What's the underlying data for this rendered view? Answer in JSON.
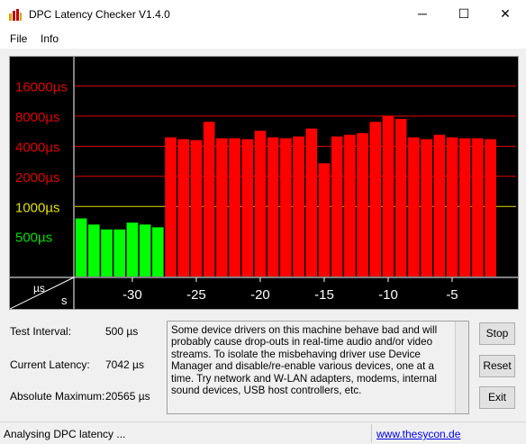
{
  "window": {
    "title": "DPC Latency Checker V1.4.0",
    "minimize_glyph": "─",
    "maximize_glyph": "☐",
    "close_glyph": "✕"
  },
  "menu": {
    "items": [
      "File",
      "Info"
    ]
  },
  "chart_data": {
    "type": "bar",
    "xlabel": "s",
    "ylabel": "µs",
    "scale": "log",
    "y_ticks": [
      {
        "label": "16000µs",
        "value": 16000,
        "color": "#e00000"
      },
      {
        "label": "8000µs",
        "value": 8000,
        "color": "#e00000"
      },
      {
        "label": "4000µs",
        "value": 4000,
        "color": "#e00000"
      },
      {
        "label": "2000µs",
        "value": 2000,
        "color": "#e00000"
      },
      {
        "label": "1000µs",
        "value": 1000,
        "color": "#e0e000"
      },
      {
        "label": "500µs",
        "value": 500,
        "color": "#00e000"
      }
    ],
    "x_ticks": [
      "-30",
      "-25",
      "-20",
      "-15",
      "-10",
      "-5"
    ],
    "x_tick_values": [
      -30,
      -25,
      -20,
      -15,
      -10,
      -5
    ],
    "x_range": [
      -34.5,
      0
    ],
    "y_range": [
      200,
      30000
    ],
    "colors": {
      "green": "#00ff00",
      "red": "#ff0000",
      "gridline": "#e00000",
      "yellow_line": "#e0e000",
      "background": "#000000"
    },
    "bars": [
      {
        "x": -34,
        "value": 760
      },
      {
        "x": -33,
        "value": 660
      },
      {
        "x": -32,
        "value": 590
      },
      {
        "x": -31,
        "value": 590
      },
      {
        "x": -30,
        "value": 690
      },
      {
        "x": -29,
        "value": 660
      },
      {
        "x": -28,
        "value": 620
      },
      {
        "x": -27,
        "value": 4900
      },
      {
        "x": -26,
        "value": 4700
      },
      {
        "x": -25,
        "value": 4600
      },
      {
        "x": -24,
        "value": 7000
      },
      {
        "x": -23,
        "value": 4800
      },
      {
        "x": -22,
        "value": 4800
      },
      {
        "x": -21,
        "value": 4700
      },
      {
        "x": -20,
        "value": 5700
      },
      {
        "x": -19,
        "value": 4900
      },
      {
        "x": -18,
        "value": 4800
      },
      {
        "x": -17,
        "value": 5000
      },
      {
        "x": -16,
        "value": 6000
      },
      {
        "x": -15,
        "value": 2700
      },
      {
        "x": -14,
        "value": 5000
      },
      {
        "x": -13,
        "value": 5200
      },
      {
        "x": -12,
        "value": 5400
      },
      {
        "x": -11,
        "value": 7000
      },
      {
        "x": -10,
        "value": 8000
      },
      {
        "x": -9,
        "value": 7500
      },
      {
        "x": -8,
        "value": 4900
      },
      {
        "x": -7,
        "value": 4700
      },
      {
        "x": -6,
        "value": 5200
      },
      {
        "x": -5,
        "value": 4900
      },
      {
        "x": -4,
        "value": 4800
      },
      {
        "x": -3,
        "value": 4800
      },
      {
        "x": -2,
        "value": 4700
      }
    ],
    "corner_top": "µs",
    "corner_bottom": "s"
  },
  "stats": {
    "test_interval_label": "Test Interval:",
    "test_interval_value": "500 µs",
    "current_latency_label": "Current Latency:",
    "current_latency_value": "7042 µs",
    "absolute_max_label": "Absolute Maximum:",
    "absolute_max_value": "20565 µs"
  },
  "message": "Some device drivers on this machine behave bad and will probably cause drop-outs in real-time audio and/or video streams. To isolate the misbehaving driver use Device Manager and disable/re-enable various devices, one at a time. Try network and W-LAN adapters, modems, internal sound devices, USB host controllers, etc.",
  "buttons": {
    "stop": "Stop",
    "reset": "Reset",
    "exit": "Exit"
  },
  "status": {
    "text": "Analysing DPC latency ...",
    "link": "www.thesycon.de"
  }
}
